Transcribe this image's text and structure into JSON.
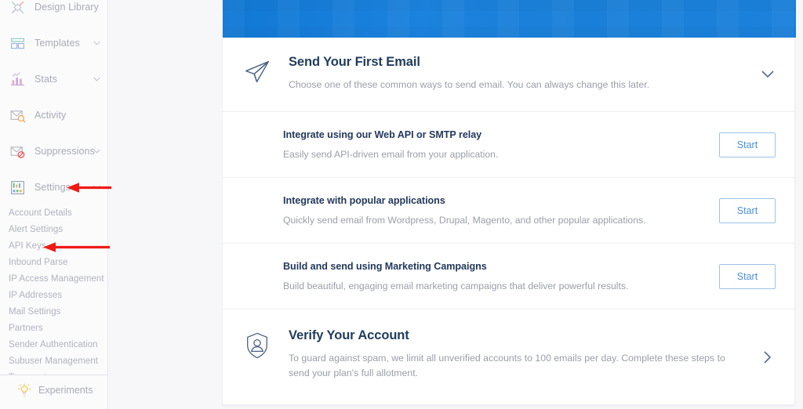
{
  "sidebar": {
    "items": [
      {
        "label": "Design Library",
        "icon": "design-library-icon",
        "has_caret": false
      },
      {
        "label": "Templates",
        "icon": "templates-icon",
        "has_caret": true
      },
      {
        "label": "Stats",
        "icon": "stats-icon",
        "has_caret": true
      },
      {
        "label": "Activity",
        "icon": "activity-icon",
        "has_caret": false
      },
      {
        "label": "Suppressions",
        "icon": "suppressions-icon",
        "has_caret": true
      },
      {
        "label": "Settings",
        "icon": "settings-icon",
        "has_caret": true
      }
    ],
    "settings_submenu": [
      "Account Details",
      "Alert Settings",
      "API Keys",
      "Inbound Parse",
      "IP Access Management",
      "IP Addresses",
      "Mail Settings",
      "Partners",
      "Sender Authentication",
      "Subuser Management",
      "Teammates"
    ],
    "experiments": {
      "label": "Experiments",
      "icon": "lightbulb-icon"
    }
  },
  "annotations": {
    "color": "#ee1b15",
    "arrows": [
      {
        "name": "settings-pointer-arrow",
        "target": "Settings"
      },
      {
        "name": "api-keys-pointer-arrow",
        "target": "API Keys"
      }
    ]
  },
  "main": {
    "banner": {
      "color_start": "#1178d4",
      "color_end": "#1b81db"
    },
    "send_email_section": {
      "icon": "paper-plane-icon",
      "title": "Send Your First Email",
      "description": "Choose one of these common ways to send email. You can always change this later.",
      "chevron": "chevron-down-icon"
    },
    "options": [
      {
        "title": "Integrate using our Web API or SMTP relay",
        "description": "Easily send API-driven email from your application.",
        "button": "Start"
      },
      {
        "title": "Integrate with popular applications",
        "description": "Quickly send email from Wordpress, Drupal, Magento, and other popular applications.",
        "button": "Start"
      },
      {
        "title": "Build and send using Marketing Campaigns",
        "description": "Build beautiful, engaging email marketing campaigns that deliver powerful results.",
        "button": "Start"
      }
    ],
    "verify_section": {
      "icon": "shield-user-icon",
      "title": "Verify Your Account",
      "description": "To guard against spam, we limit all unverified accounts to 100 emails per day. Complete these steps to send your plan's full allotment.",
      "chevron": "chevron-right-icon"
    }
  }
}
